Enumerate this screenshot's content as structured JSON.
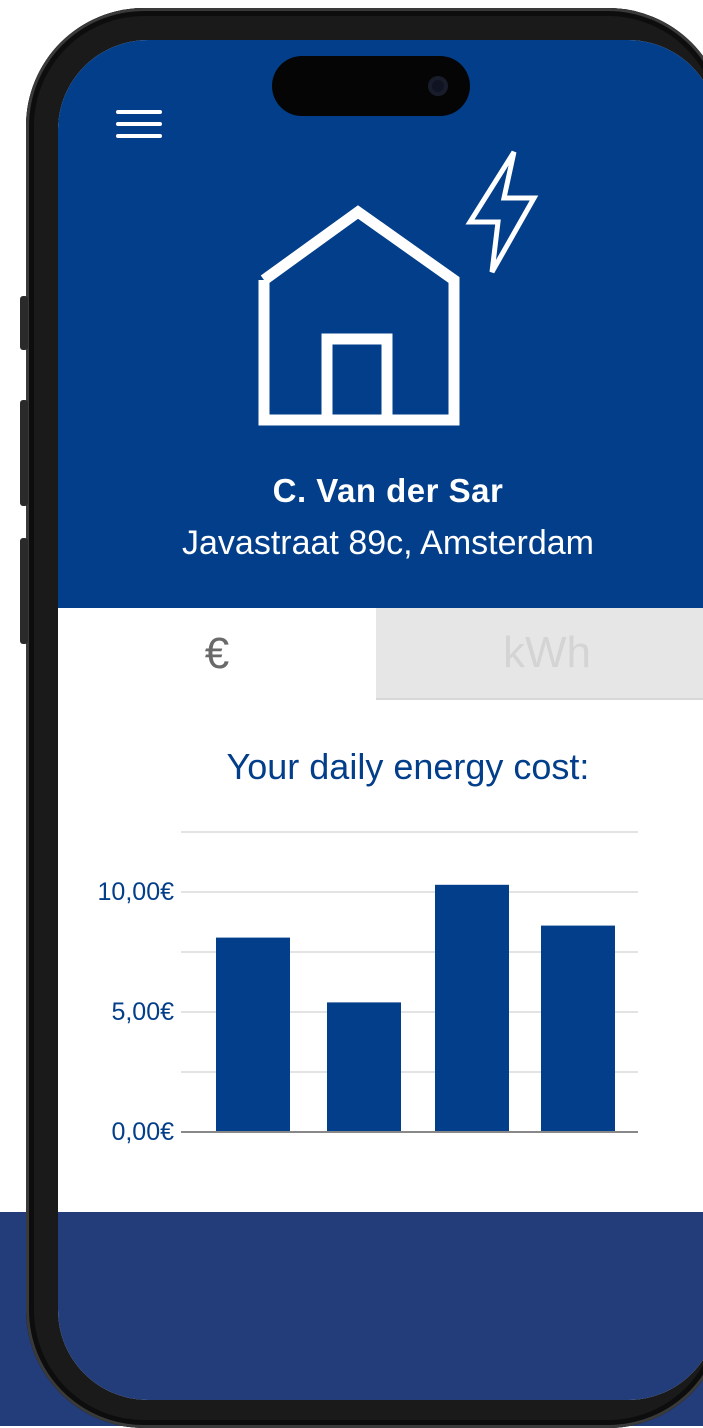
{
  "header": {
    "menu_icon": "hamburger-menu-icon",
    "hero_icon": "house-lightning-icon",
    "name": "C. Van der Sar",
    "address": "Javastraat 89c, Amsterdam"
  },
  "tabs": [
    {
      "label": "€",
      "active": true
    },
    {
      "label": "kWh",
      "active": false
    }
  ],
  "chart_title": "Your daily energy cost:",
  "colors": {
    "primary": "#023e8a",
    "footer": "#223d7a",
    "inactive_tab": "#e6e6e6"
  },
  "chart_data": {
    "type": "bar",
    "categories": [
      "",
      "",
      "",
      ""
    ],
    "values": [
      8.1,
      5.4,
      10.3,
      8.6
    ],
    "ylim": [
      0,
      12.5
    ],
    "yticks": [
      {
        "value": 0,
        "label": "0,00€"
      },
      {
        "value": 5,
        "label": "5,00€"
      },
      {
        "value": 10,
        "label": "10,00€"
      }
    ],
    "gridlines": [
      2.5,
      5,
      7.5,
      10,
      12.5
    ],
    "grid": true,
    "color": "#023e8a"
  }
}
